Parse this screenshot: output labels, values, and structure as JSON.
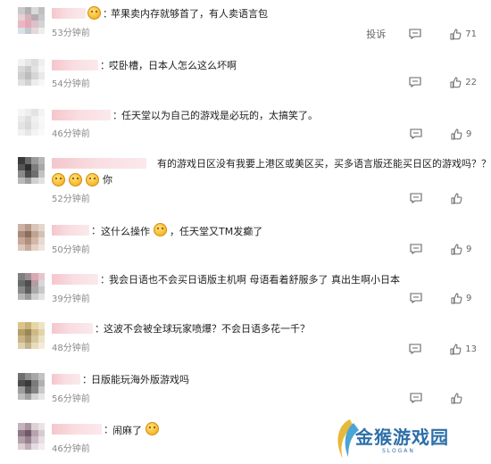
{
  "actions": {
    "report_label": "投诉"
  },
  "comments": [
    {
      "text": "苹果卖内存就够首了，有人卖语言包",
      "time": "53分钟前",
      "likes": "71",
      "avatar": [
        "#c9c9c9",
        "#b0b0b0",
        "#d9d9d9",
        "#bfbfbf",
        "#e8d0d6",
        "#d7b2bb",
        "#b8aab2",
        "#c8c8c8",
        "#e9b6c2",
        "#e6a7b5",
        "#ddc1c9",
        "#d3d3d3",
        "#d9e0e6",
        "#c0c8d0",
        "#e7d6da",
        "#eeeeee"
      ]
    },
    {
      "text": "哎卧槽，日本人怎么这么坏啊",
      "time": "54分钟前",
      "likes": "22",
      "avatar": [
        "#f2f2f2",
        "#e6e6e6",
        "#dcdcdc",
        "#efefef",
        "#d8d8d8",
        "#c9c9c9",
        "#e2e2e2",
        "#f4f4f4",
        "#cfcfcf",
        "#bcbcbc",
        "#d6d6d6",
        "#e9e9e9",
        "#e0e0e0",
        "#d2d2d2",
        "#ededed",
        "#f7f7f7"
      ]
    },
    {
      "text": "任天堂以为自己的游戏是必玩的，太搞笑了。",
      "time": "46分钟前",
      "likes": "9",
      "avatar": [
        "#f5f5f5",
        "#eeeeee",
        "#e3e3e3",
        "#f3f3f3",
        "#ebebeb",
        "#dedede",
        "#f0f0f0",
        "#f8f8f8",
        "#e4e4e4",
        "#d9d9d9",
        "#ececec",
        "#f6f6f6",
        "#f1f1f1",
        "#e6e6e6",
        "#f4f4f4",
        "#fafafa"
      ]
    },
    {
      "text": "有的游戏日区没有我要上港区或美区买，买多语言版还能买日区的游戏吗？？？",
      "extra": "你",
      "time": "52分钟前",
      "likes": "",
      "avatar": [
        "#3a3a3a",
        "#6b6b6b",
        "#9a9a9a",
        "#b5b5b5",
        "#555555",
        "#2e2e2e",
        "#7d7d7d",
        "#a8a8a8",
        "#8a8a8a",
        "#4a4a4a",
        "#6f6f6f",
        "#c2c2c2",
        "#b9b9b9",
        "#9d9d9d",
        "#d0d0d0",
        "#e1e1e1"
      ]
    },
    {
      "text": "这什么操作",
      "text2": "，任天堂又TM发癫了",
      "time": "50分钟前",
      "likes": "9",
      "avatar": [
        "#c9b3a6",
        "#b89a8a",
        "#d8c4b8",
        "#e4d6cc",
        "#a88a7a",
        "#8c6e5e",
        "#bfa392",
        "#d6c0b2",
        "#caa898",
        "#b08f7e",
        "#d2b7a8",
        "#e7d9cf",
        "#dcc8bc",
        "#c7ab9c",
        "#e3d1c6",
        "#efe4dc"
      ]
    },
    {
      "text": "我会日语也不会买日语版主机啊 母语看着舒服多了 真出生啊小日本",
      "time": "39分钟前",
      "likes": "9",
      "avatar": [
        "#7f7f7f",
        "#9f8e90",
        "#d9a8b3",
        "#e7c4cc",
        "#6a6a6a",
        "#4f4f4f",
        "#b59ca3",
        "#d7d7d7",
        "#8a8a8a",
        "#5e5e5e",
        "#a9a9a9",
        "#c8c8c8",
        "#b6b6b6",
        "#999999",
        "#cfcfcf",
        "#e2e2e2"
      ]
    },
    {
      "text": "这波不会被全球玩家喷爆？不会日语多花一千？",
      "time": "48分钟前",
      "likes": "13",
      "avatar": [
        "#d9c58a",
        "#c7b277",
        "#e6d6a3",
        "#efe4c2",
        "#b39f68",
        "#9b8655",
        "#cdb987",
        "#e2d3a8",
        "#c9b585",
        "#ad9a6c",
        "#d6c79e",
        "#ece2c4",
        "#dfd1ad",
        "#c4b38d",
        "#e8dcbd",
        "#f3ecd8"
      ]
    },
    {
      "text": "日版能玩海外版游戏吗",
      "time": "56分钟前",
      "likes": "",
      "avatar": [
        "#6f6f6f",
        "#8f8f8f",
        "#a7a7a7",
        "#c2c2c2",
        "#4c4c4c",
        "#3a3a3a",
        "#7a7a7a",
        "#b0b0b0",
        "#9c9c9c",
        "#5c5c5c",
        "#848484",
        "#c9c9c9",
        "#bdbdbd",
        "#a0a0a0",
        "#d3d3d3",
        "#e6e6e6"
      ]
    },
    {
      "text": "闹麻了",
      "time": "46分钟前",
      "likes": "",
      "avatar": [
        "#c6b2bd",
        "#a995a2",
        "#ddd0d6",
        "#eae2e6",
        "#8c7784",
        "#6e5a66",
        "#b7a2ae",
        "#d8cad1",
        "#b3a0ab",
        "#96808e",
        "#c9bac2",
        "#e7dde2",
        "#dccfd6",
        "#bfaeb8",
        "#e6dbe0",
        "#f2ecef"
      ]
    }
  ],
  "watermark": {
    "title": "金猴游戏园",
    "subtitle": "SLOGAN"
  }
}
